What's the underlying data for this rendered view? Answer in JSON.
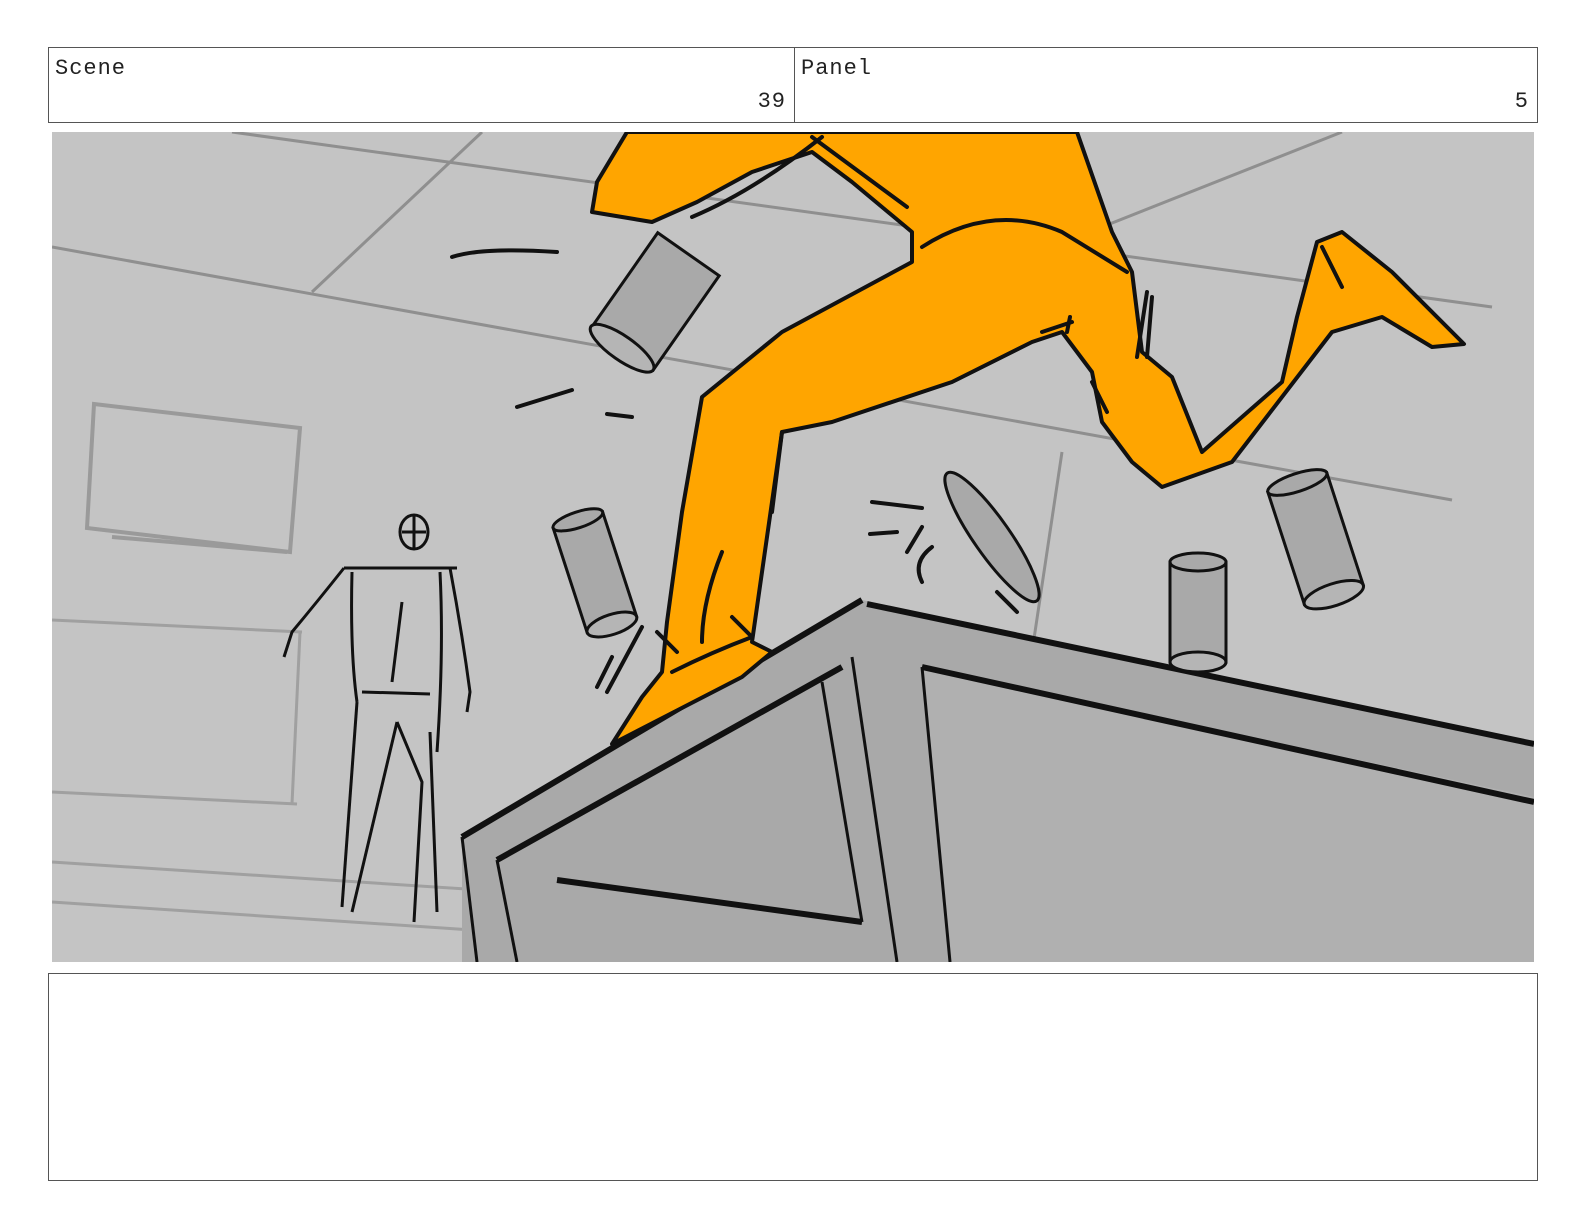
{
  "header": {
    "scene_label": "Scene",
    "scene_number": "39",
    "panel_label": "Panel",
    "panel_number": "5"
  },
  "notes": {
    "text": ""
  },
  "colors": {
    "background_gray": "#c4c4c4",
    "object_gray": "#a9a9a9",
    "character_orange": "#ffa500",
    "ink": "#111111"
  }
}
